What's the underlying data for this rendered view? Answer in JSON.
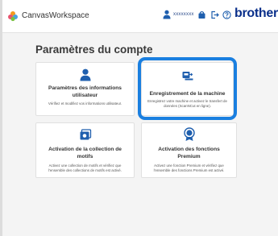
{
  "header": {
    "app_name": "CanvasWorkspace",
    "user_name": "xxxxxxxx",
    "brand": "brother",
    "icons": [
      "user-icon",
      "bag-icon",
      "logout-icon",
      "help-icon"
    ]
  },
  "page": {
    "title": "Paramètres du compte"
  },
  "cards": [
    {
      "icon": "user-icon",
      "title": "Paramètres des informations utilisateur",
      "desc": "Vérifiez et modifiez vos informations utilisateur."
    },
    {
      "icon": "machine-icon",
      "title": "Enregistrement de la machine",
      "desc": "Enregistrez votre machine et activez le transfert de données (ScanNCut en ligne).",
      "highlighted": true
    },
    {
      "icon": "pattern-collection-icon",
      "title": "Activation de la collection de motifs",
      "desc": "Activez une collection de motifs et vérifiez que l'ensemble des collections de motifs est activé."
    },
    {
      "icon": "premium-medal-icon",
      "title": "Activation des fonctions Premium",
      "desc": "Activez une fonction Premium et vérifiez que l'ensemble des fonctions Premium est activé."
    }
  ],
  "colors": {
    "accent_highlight": "#1a7fe0",
    "brand": "#0a2f8a",
    "icon_blue": "#1f5fae"
  }
}
